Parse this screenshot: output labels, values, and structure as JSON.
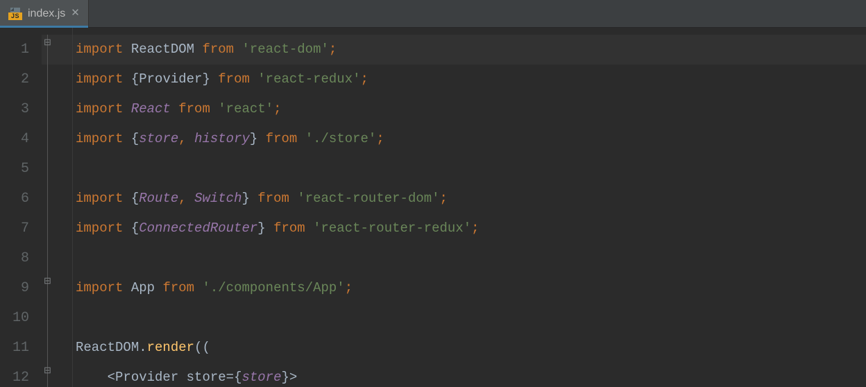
{
  "tab": {
    "filename": "index.js",
    "icon_badge": "JS"
  },
  "gutter": {
    "lines": [
      "1",
      "2",
      "3",
      "4",
      "5",
      "6",
      "7",
      "8",
      "9",
      "10",
      "11",
      "12"
    ]
  },
  "code": {
    "kw_import": "import",
    "kw_from": "from",
    "sp": " ",
    "semicolon": ";",
    "comma_sp": ", ",
    "lbrace": "{",
    "rbrace": "}",
    "lparen": "(",
    "rparen": ")",
    "lt": "<",
    "gt": ">",
    "eq": "=",
    "dot": ".",
    "l1": {
      "id": "ReactDOM",
      "mod": "'react-dom'"
    },
    "l2": {
      "id": "Provider",
      "mod": "'react-redux'"
    },
    "l3": {
      "id": "React",
      "mod": "'react'"
    },
    "l4": {
      "id1": "store",
      "id2": "history",
      "mod": "'./store'"
    },
    "l6": {
      "id1": "Route",
      "id2": "Switch",
      "mod": "'react-router-dom'"
    },
    "l7": {
      "id": "ConnectedRouter",
      "mod": "'react-router-redux'"
    },
    "l9": {
      "id": "App",
      "mod": "'./components/App'"
    },
    "l11": {
      "obj": "ReactDOM",
      "method": "render"
    },
    "l12": {
      "indent": "    ",
      "tag": "Provider",
      "attr": "store",
      "val": "store"
    }
  }
}
